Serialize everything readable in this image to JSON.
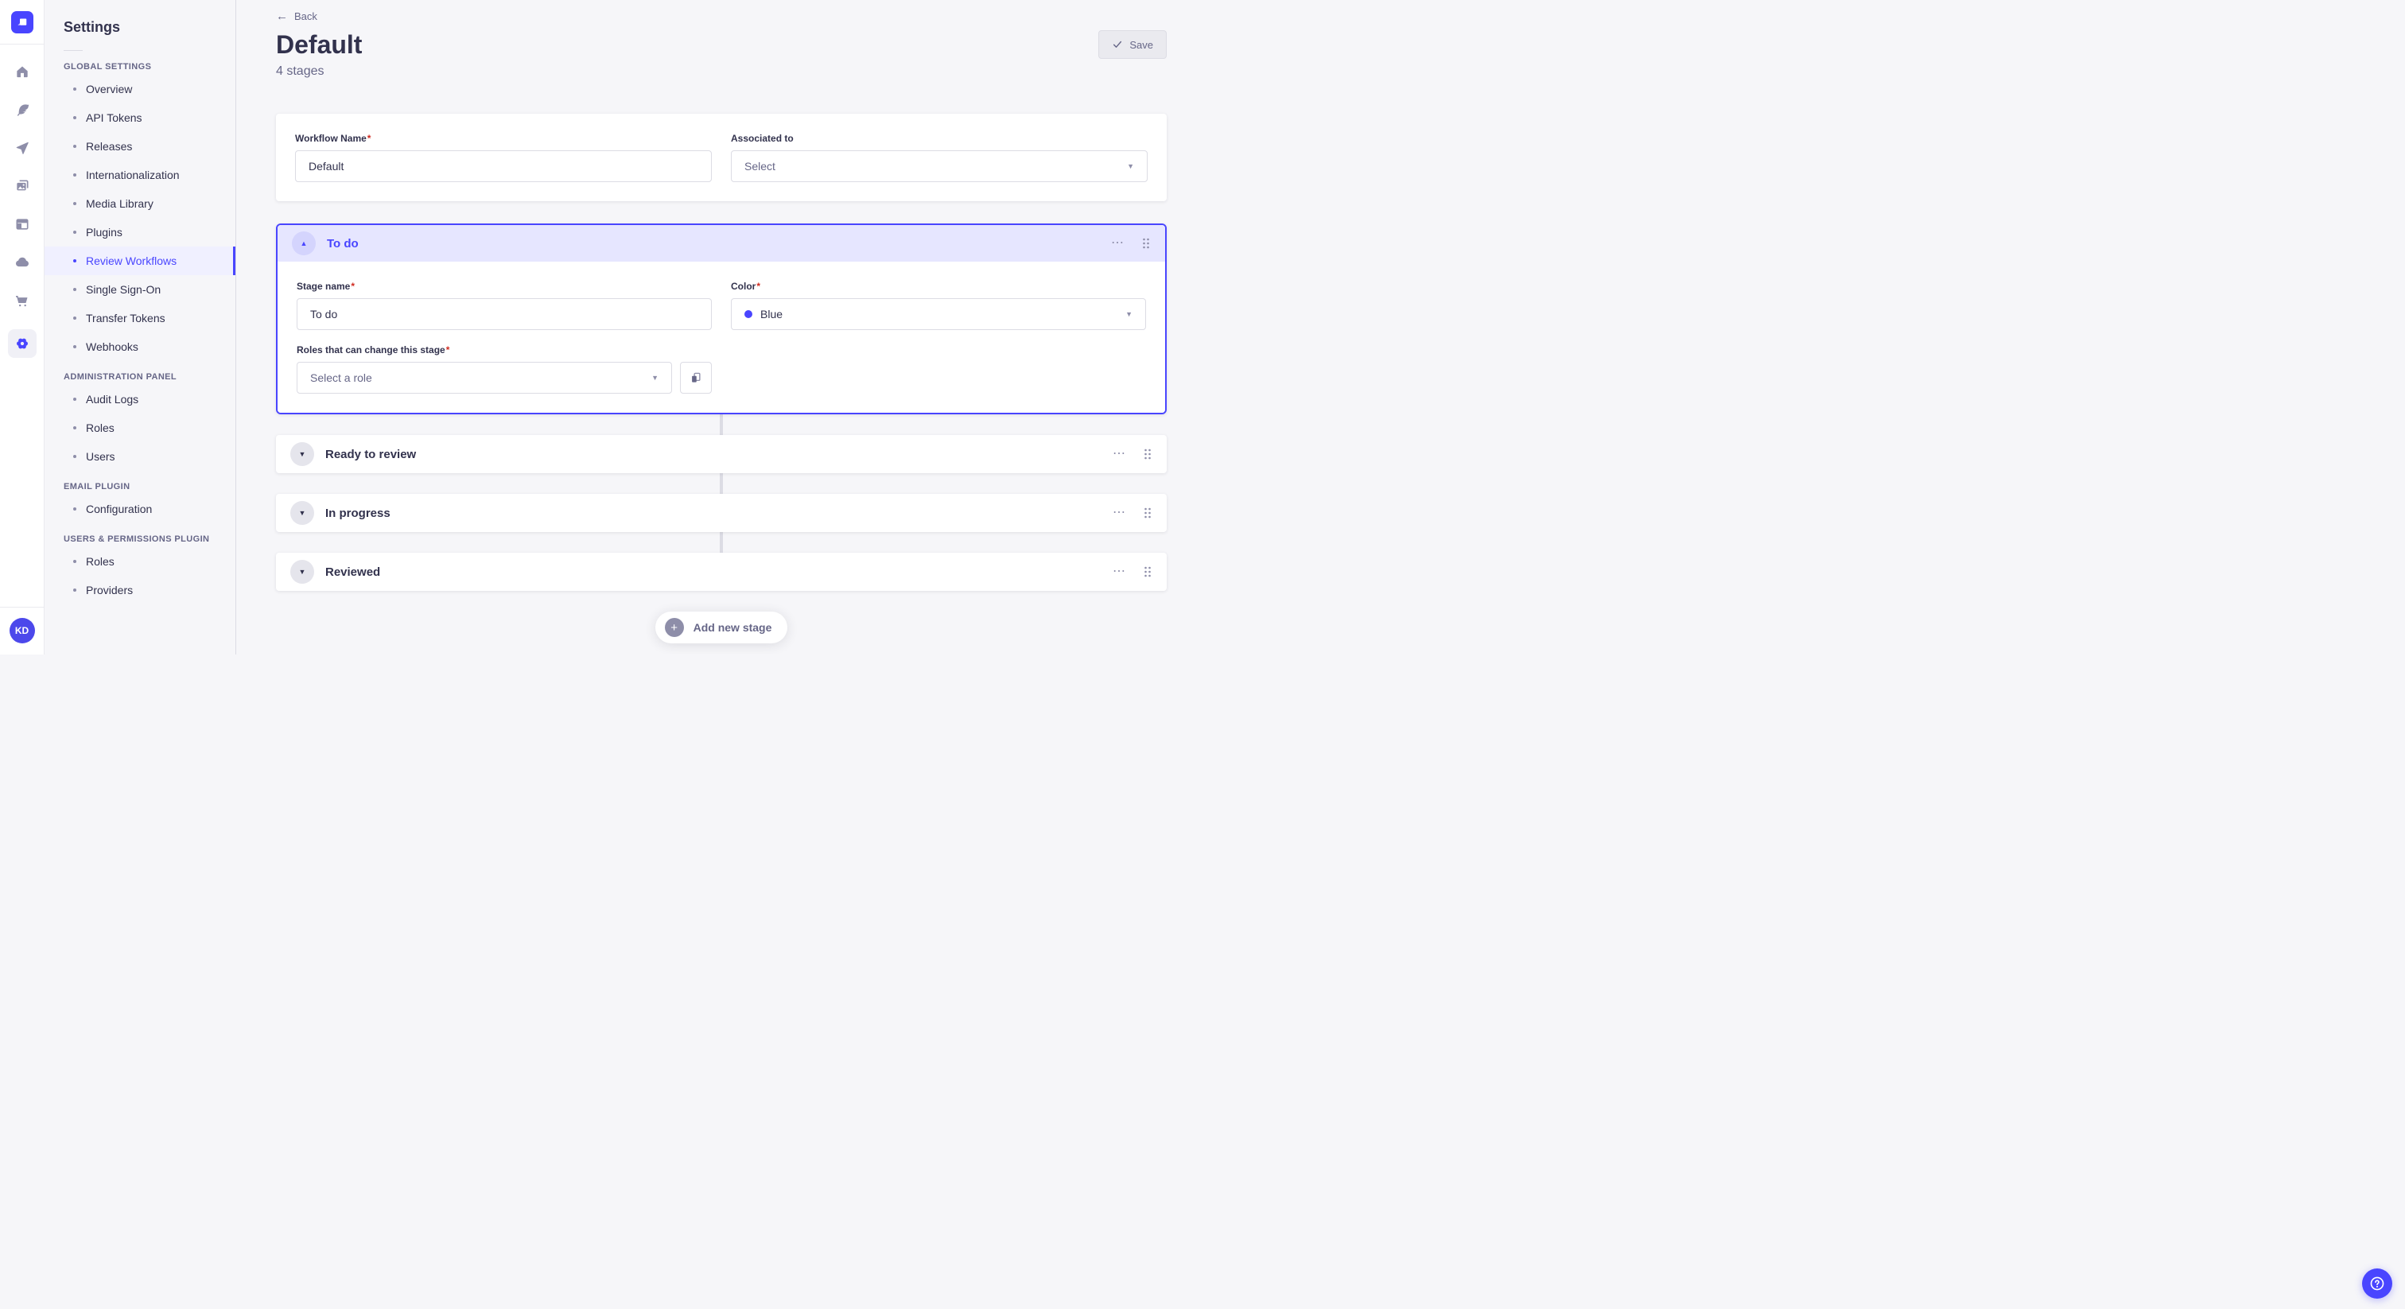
{
  "colors": {
    "accent": "#4945ff",
    "active_item_bg": "#f0f0ff",
    "stage_header_bg": "#e6e6ff",
    "required": "#d02b20",
    "stage_color_hex": "#4945ff"
  },
  "icons": {
    "back_arrow": "←",
    "check": "✓",
    "more": "⋯",
    "collapse_triangle": "▲",
    "expand_triangle": "▼",
    "chevron_down": "▼",
    "plus": "+"
  },
  "ui": {
    "required_mark": "*"
  },
  "nav_rail": {
    "avatar_initials": "KD"
  },
  "sidebar": {
    "title": "Settings",
    "sections": [
      {
        "label": "GLOBAL SETTINGS",
        "items": [
          "Overview",
          "API Tokens",
          "Releases",
          "Internationalization",
          "Media Library",
          "Plugins",
          "Review Workflows",
          "Single Sign-On",
          "Transfer Tokens",
          "Webhooks"
        ],
        "active_item": "Review Workflows"
      },
      {
        "label": "ADMINISTRATION PANEL",
        "items": [
          "Audit Logs",
          "Roles",
          "Users"
        ]
      },
      {
        "label": "EMAIL PLUGIN",
        "items": [
          "Configuration"
        ]
      },
      {
        "label": "USERS & PERMISSIONS PLUGIN",
        "items": [
          "Roles",
          "Providers"
        ]
      }
    ]
  },
  "header": {
    "back_label": "Back",
    "title": "Default",
    "subtitle": "4 stages",
    "save_label": "Save"
  },
  "form": {
    "workflow_name_label": "Workflow Name",
    "workflow_name_value": "Default",
    "associated_label": "Associated to",
    "associated_placeholder": "Select"
  },
  "stage_editor": {
    "stage_name_label": "Stage name",
    "color_label": "Color",
    "roles_label": "Roles that can change this stage",
    "roles_placeholder": "Select a role"
  },
  "stages": [
    {
      "name": "To do",
      "expanded": true,
      "color_name": "Blue",
      "color_hex": "#4945ff"
    },
    {
      "name": "Ready to review",
      "expanded": false
    },
    {
      "name": "In progress",
      "expanded": false
    },
    {
      "name": "Reviewed",
      "expanded": false
    }
  ],
  "footer": {
    "add_stage_label": "Add new stage"
  }
}
